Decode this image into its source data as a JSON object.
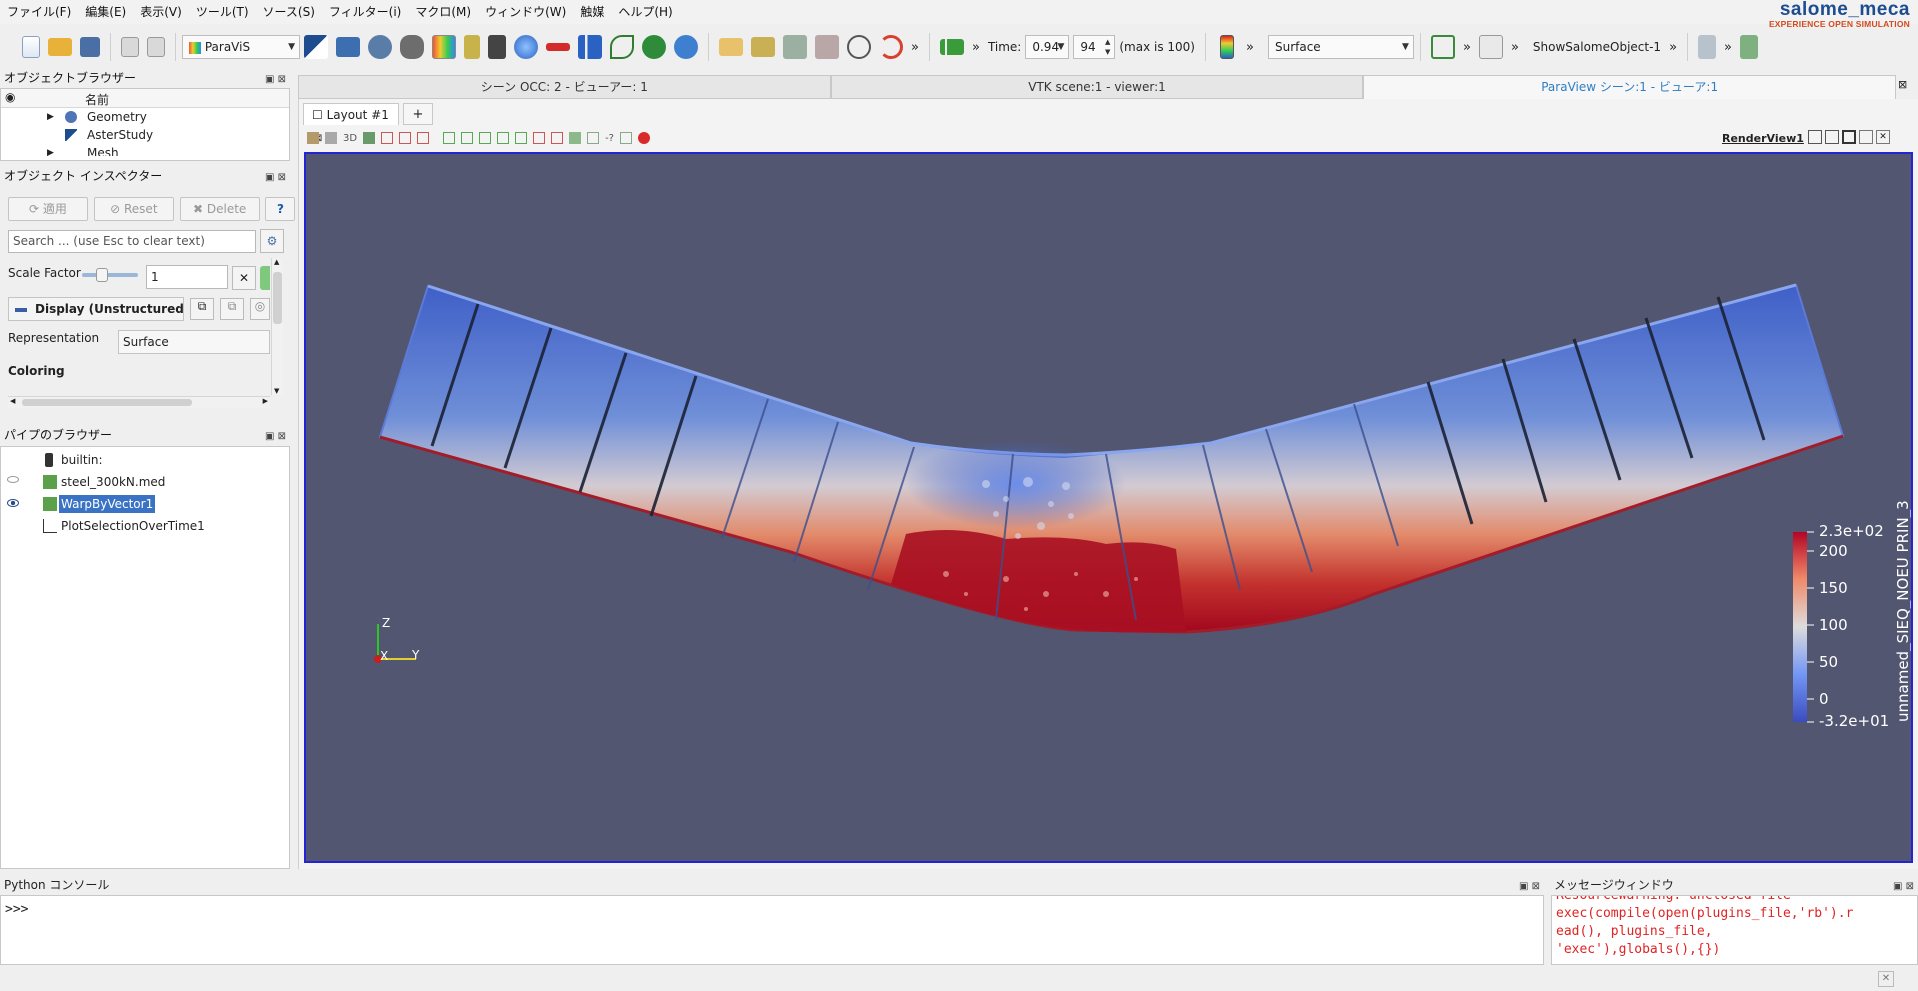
{
  "menubar": {
    "items": [
      "ファイル(F)",
      "編集(E)",
      "表示(V)",
      "ツール(T)",
      "ソース(S)",
      "フィルター(i)",
      "マクロ(M)",
      "ウィンドウ(W)",
      "触媒",
      "ヘルプ(H)"
    ],
    "logo_title": "salome_meca",
    "logo_subtitle": "EXPERIENCE OPEN SIMULATION"
  },
  "toolbar": {
    "module_combo": "ParaViS",
    "time_label": "Time:",
    "time_value": "0.94",
    "timestep_value": "94",
    "timestep_max": "(max is 100)",
    "representation_combo": "Surface",
    "macro_label": "ShowSalomeObject-1",
    "more": "»"
  },
  "object_browser": {
    "title": "オブジェクトブラウザー",
    "column_name": "名前",
    "items": [
      "Geometry",
      "AsterStudy",
      "Mesh"
    ]
  },
  "object_inspector": {
    "title": "オブジェクト インスペクター",
    "apply_label": "適用",
    "reset_label": "Reset",
    "delete_label": "Delete",
    "help_label": "?",
    "search_placeholder": "Search ... (use Esc to clear text)",
    "scale_factor_label": "Scale Factor",
    "scale_factor_value": "1",
    "scale_factor_slider": 0.35,
    "display_label": "Display (UnstructuredG",
    "representation_label": "Representation",
    "representation_value": "Surface",
    "coloring_label": "Coloring"
  },
  "pipeline_browser": {
    "title": "パイプのブラウザー",
    "items": [
      "builtin:",
      "steel_300kN.med",
      "WarpByVector1",
      "PlotSelectionOverTime1"
    ]
  },
  "view_tabs": [
    "シーン OCC: 2 - ビューアー: 1",
    "VTK scene:1 - viewer:1",
    "ParaView シーン:1 - ビューア:1"
  ],
  "layout_tab": {
    "label": "Layout #1",
    "add_label": "+"
  },
  "render_view": {
    "view_label": "RenderView1",
    "mini_3d_label": "3D",
    "background": "#525670"
  },
  "color_legend": {
    "title": "unnamed_SIEQ_NOEU PRIN_3",
    "max_label": "2.3e+02",
    "min_label": "-3.2e+01",
    "ticks": [
      "200",
      "150",
      "100",
      "50",
      "0"
    ]
  },
  "axes": {
    "z": "Z",
    "x": "X",
    "y": "Y"
  },
  "python_console": {
    "title": "Python コンソール",
    "prompt": ">>>"
  },
  "message_window": {
    "title": "メッセージウィンドウ",
    "lines": [
      "ResourceWarning: unclosed file",
      "exec(compile(open(plugins_file,'rb').r",
      "ead(), plugins_file,",
      "'exec'),globals(),{})"
    ]
  },
  "colors": {
    "accent_tab": "#2e7ec4",
    "selection": "#3b73c4",
    "render_border": "#2323d8",
    "error_text": "#e02424"
  }
}
